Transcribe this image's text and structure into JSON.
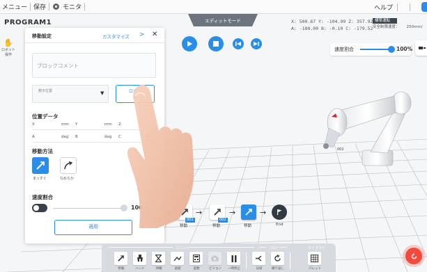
{
  "menubar": {
    "menu": "メニュー",
    "save": "保存",
    "monitor": "モニタ",
    "help": "ヘルプ"
  },
  "program": {
    "title": "PROGRAM1",
    "mode": "エディットモード"
  },
  "coordinates": {
    "line1": "X:  500.67 Y:  -104.99 Z:  357.92",
    "line2": "A: -180.00 B:    -0.10 C: -179.52"
  },
  "status": {
    "badge": "標準運転",
    "speed_label": "安全制限速度：",
    "speed_value": "250mm/"
  },
  "siderail": {
    "label1": "ロボット",
    "label2": "操作"
  },
  "speed_top": {
    "label": "速度割合",
    "value": "100%",
    "level": 1.0
  },
  "panel": {
    "title": "移動設定",
    "customize": "カスタマイズ",
    "chevron": ">",
    "close": "✕",
    "comment_placeholder": "ブロックコメント",
    "position_label": "教示位置",
    "robot_button_l1": "ロボッ",
    "robot_button_l2": "教",
    "position_data_title": "位置データ",
    "pd_row1": [
      "X",
      "mm",
      "Y",
      "mm",
      "Z"
    ],
    "pd_row2": [
      "A",
      "deg",
      "B",
      "deg",
      "C",
      "de"
    ],
    "move_method_title": "移動方法",
    "move_straight": "まっすぐ",
    "move_smooth": "なめらか",
    "speed_title": "速度割合",
    "speed_value": "100",
    "speed_unit": "%",
    "apply": "適用"
  },
  "flow": {
    "nodes": [
      {
        "label": "移動",
        "tag": "001"
      },
      {
        "label": "移動",
        "tag": "002"
      },
      {
        "label": "移動",
        "tag": ""
      },
      {
        "label": "End",
        "tag": ""
      }
    ]
  },
  "commandbar": {
    "command_caption": "コマンド",
    "flow_caption": "フロー",
    "library_caption": "ライブラリ",
    "buttons": [
      {
        "label": "移動"
      },
      {
        "label": "ハンド"
      },
      {
        "label": "待機"
      },
      {
        "label": "退避"
      },
      {
        "label": "変数"
      },
      {
        "label": "ビジョン"
      },
      {
        "label": "一時停止"
      },
      {
        "label": "分岐"
      },
      {
        "label": "繰り返し"
      },
      {
        "label": "パレット"
      }
    ]
  },
  "robot": {
    "arm_tag": "002"
  },
  "colors": {
    "accent": "#2b8ee6",
    "dark": "#333a42",
    "alert": "#f24b3e"
  }
}
